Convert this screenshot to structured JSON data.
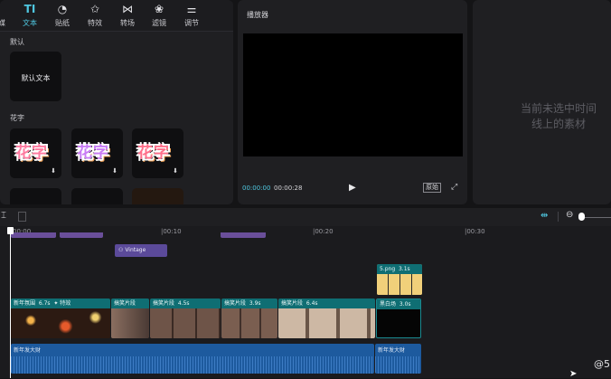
{
  "toolbar": {
    "items": [
      {
        "icon": "media-icon",
        "label": "媒",
        "glyph": ""
      },
      {
        "icon": "text-icon",
        "label": "文本",
        "glyph": "TI",
        "active": true
      },
      {
        "icon": "sticker-icon",
        "label": "贴纸",
        "glyph": "◔"
      },
      {
        "icon": "effects-icon",
        "label": "特效",
        "glyph": "✩"
      },
      {
        "icon": "transition-icon",
        "label": "转场",
        "glyph": "⋈"
      },
      {
        "icon": "filter-icon",
        "label": "滤镜",
        "glyph": "❀"
      },
      {
        "icon": "adjust-icon",
        "label": "调节",
        "glyph": "⚌"
      }
    ]
  },
  "left": {
    "section_default": "默认",
    "default_text_tile": "默认文本",
    "section_fancy": "花字",
    "fancy_tile_text": "花字"
  },
  "player": {
    "title": "播放器",
    "current_time": "00:00:00",
    "total_time": "00:00:28",
    "ratio_button": "原始"
  },
  "right": {
    "empty_message_line1": "当前未选中时间",
    "empty_message_line2": "线上的素材"
  },
  "timeline": {
    "ruler_labels": [
      "00:00",
      "|00:10",
      "|00:20",
      "|00:30"
    ],
    "filter_clip": "Vintage",
    "sticker_clip": {
      "name": "5.png",
      "duration": "3.1s"
    },
    "video_clips": [
      {
        "name": "新年氛围",
        "duration": "6.7s",
        "effect": "特效"
      },
      {
        "name": "搞笑片段",
        "duration": ""
      },
      {
        "name": "搞笑片段",
        "duration": "4.5s"
      },
      {
        "name": "搞笑片段",
        "duration": "3.9s"
      },
      {
        "name": "搞笑片段",
        "duration": "6.4s"
      },
      {
        "name": "黑白场",
        "duration": "3.0s"
      }
    ],
    "audio_clips": [
      "新年发大财",
      "新年发大财"
    ],
    "watermark": "@5"
  },
  "colors": {
    "accent": "#4fc7e0",
    "video_header": "#0f6e73",
    "audio": "#1d5a9e",
    "filter_clip": "#5b4a9a"
  }
}
